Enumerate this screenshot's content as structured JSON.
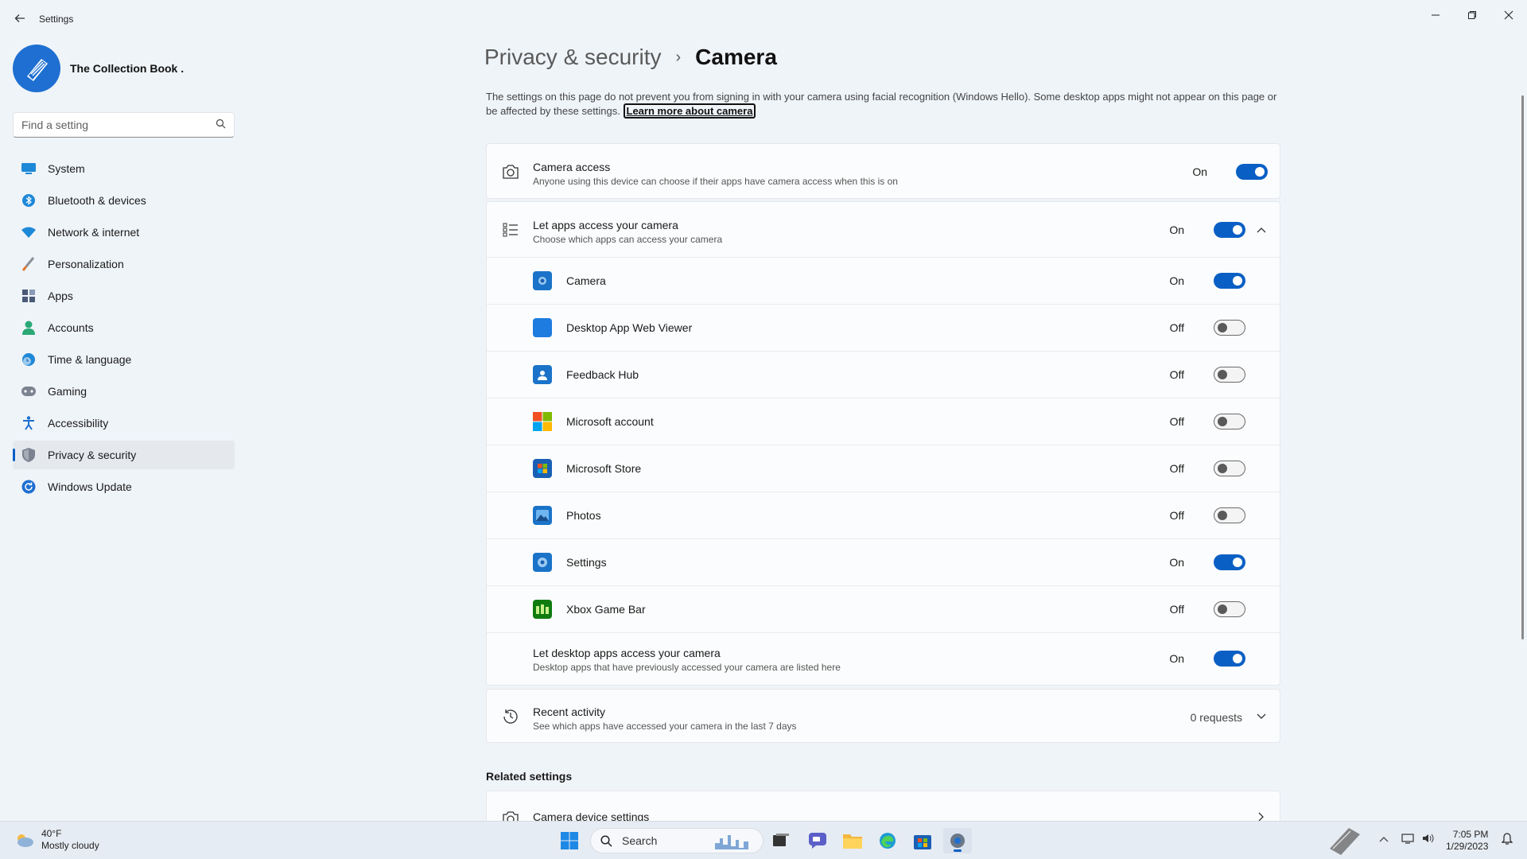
{
  "window": {
    "title": "Settings",
    "back_icon": "arrow-left",
    "minimize_glyph": "—",
    "maximize_glyph": "❐",
    "close_glyph": "✕"
  },
  "profile": {
    "name": "The Collection Book ."
  },
  "search": {
    "placeholder": "Find a setting"
  },
  "sidebar": {
    "items": [
      {
        "label": "System",
        "icon": "monitor-icon",
        "color": "#1e88d8"
      },
      {
        "label": "Bluetooth & devices",
        "icon": "bluetooth-icon",
        "color": "#1e88d8"
      },
      {
        "label": "Network & internet",
        "icon": "wifi-icon",
        "color": "#1e88d8"
      },
      {
        "label": "Personalization",
        "icon": "brush-icon",
        "color": "#e0762a"
      },
      {
        "label": "Apps",
        "icon": "apps-icon",
        "color": "#4a5a78"
      },
      {
        "label": "Accounts",
        "icon": "person-icon",
        "color": "#2aa876"
      },
      {
        "label": "Time & language",
        "icon": "globe-clock-icon",
        "color": "#1e88d8"
      },
      {
        "label": "Gaming",
        "icon": "gamepad-icon",
        "color": "#6b7280"
      },
      {
        "label": "Accessibility",
        "icon": "accessibility-icon",
        "color": "#1e6fd1"
      },
      {
        "label": "Privacy & security",
        "icon": "shield-icon",
        "color": "#6b7280",
        "active": true
      },
      {
        "label": "Windows Update",
        "icon": "refresh-icon",
        "color": "#1e6fd1"
      }
    ]
  },
  "breadcrumb": {
    "parent": "Privacy & security",
    "separator": "›",
    "current": "Camera"
  },
  "intro": {
    "text": "The settings on this page do not prevent you from signing in with your camera using facial recognition (Windows Hello). Some desktop apps might not appear on this page or be affected by these settings.",
    "link": "Learn more about camera"
  },
  "camera_access": {
    "title": "Camera access",
    "subtitle": "Anyone using this device can choose if their apps have camera access when this is on",
    "state": "On",
    "on": true
  },
  "let_apps": {
    "title": "Let apps access your camera",
    "subtitle": "Choose which apps can access your camera",
    "state": "On",
    "on": true
  },
  "apps": [
    {
      "name": "Camera",
      "state": "On",
      "on": true,
      "icon": "camera-app-icon",
      "color": "#1a73c8"
    },
    {
      "name": "Desktop App Web Viewer",
      "state": "Off",
      "on": false,
      "icon": "web-viewer-icon",
      "color": "#1e7be0"
    },
    {
      "name": "Feedback Hub",
      "state": "Off",
      "on": false,
      "icon": "feedback-hub-icon",
      "color": "#1a73c8"
    },
    {
      "name": "Microsoft account",
      "state": "Off",
      "on": false,
      "icon": "microsoft-logo-icon",
      "color": "#f25022"
    },
    {
      "name": "Microsoft Store",
      "state": "Off",
      "on": false,
      "icon": "store-icon",
      "color": "#1a5fb4"
    },
    {
      "name": "Photos",
      "state": "Off",
      "on": false,
      "icon": "photos-icon",
      "color": "#1a73c8"
    },
    {
      "name": "Settings",
      "state": "On",
      "on": true,
      "icon": "settings-app-icon",
      "color": "#1a73c8"
    },
    {
      "name": "Xbox Game Bar",
      "state": "Off",
      "on": false,
      "icon": "xbox-game-bar-icon",
      "color": "#107c10"
    }
  ],
  "desktop_apps": {
    "title": "Let desktop apps access your camera",
    "subtitle": "Desktop apps that have previously accessed your camera are listed here",
    "state": "On",
    "on": true
  },
  "recent_activity": {
    "title": "Recent activity",
    "subtitle": "See which apps have accessed your camera in the last 7 days",
    "count": "0 requests"
  },
  "related": {
    "heading": "Related settings",
    "items": [
      {
        "title": "Camera device settings"
      }
    ]
  },
  "taskbar": {
    "weather_temp": "40°F",
    "weather_desc": "Mostly cloudy",
    "search_label": "Search",
    "time": "7:05 PM",
    "date": "1/29/2023"
  },
  "colors": {
    "accent": "#0a5fc4",
    "background": "#eff4f9"
  }
}
